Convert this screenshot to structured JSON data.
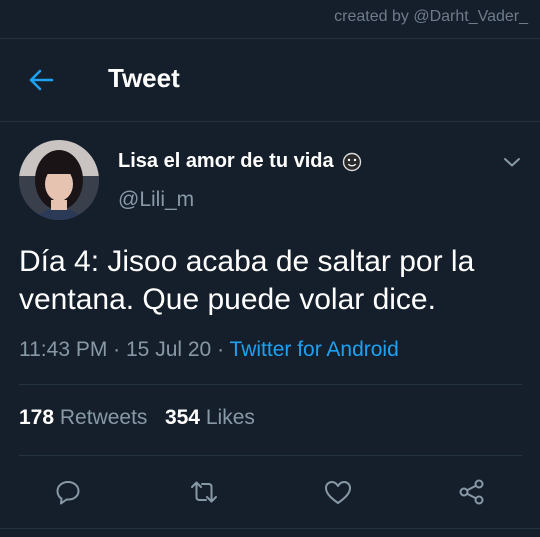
{
  "watermark": "created by @Darht_Vader_",
  "header": {
    "title": "Tweet",
    "back_icon": "arrow-left-icon"
  },
  "tweet": {
    "display_name": "Lisa el amor de tu vida",
    "name_emoji": "☻",
    "handle": "@Lili_m",
    "text": "Día 4: Jisoo acaba de saltar por la ventana. Que puede volar dice.",
    "time": "11:43 PM",
    "date": "15 Jul 20",
    "separator": " · ",
    "source": "Twitter for Android",
    "retweets": "178",
    "retweets_label": "Retweets",
    "likes": "354",
    "likes_label": "Likes"
  },
  "actions": [
    "reply-icon",
    "retweet-icon",
    "like-icon",
    "share-icon"
  ],
  "colors": {
    "background": "#151f2b",
    "accent": "#1da1f2",
    "muted": "#8899a6",
    "divider": "#243342"
  }
}
